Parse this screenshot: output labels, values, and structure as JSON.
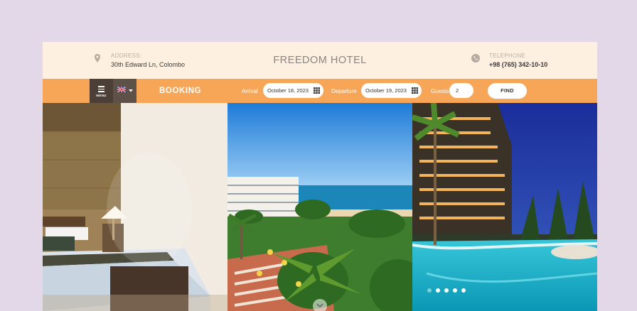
{
  "header": {
    "address_label": "ADDRESS:",
    "address_value": "30th Edward Ln, Colombo",
    "hotel_name": "FREEDOM HOTEL",
    "phone_label": "TELEPHONE",
    "phone_value": "+98 (765) 342-10-10"
  },
  "booking": {
    "menu_label": "MENU",
    "title": "BOOKING",
    "arrival_label": "Arrival",
    "arrival_value": "October 18, 2023",
    "departure_label": "Departure",
    "departure_value": "October 19, 2023",
    "guests_label": "Guests",
    "guests_value": "2",
    "find_label": "FIND"
  },
  "icons": {
    "address": "map-pin-icon",
    "phone": "phone-icon",
    "menu": "hamburger-icon",
    "language": "uk-flag-icon",
    "calendar": "calendar-icon",
    "scroll": "chevron-down-icon"
  },
  "colors": {
    "accent": "#f7a658",
    "infobar": "#fdf0e1",
    "menu_bg": "#4b3f38",
    "page_bg": "#e3d8e8"
  }
}
